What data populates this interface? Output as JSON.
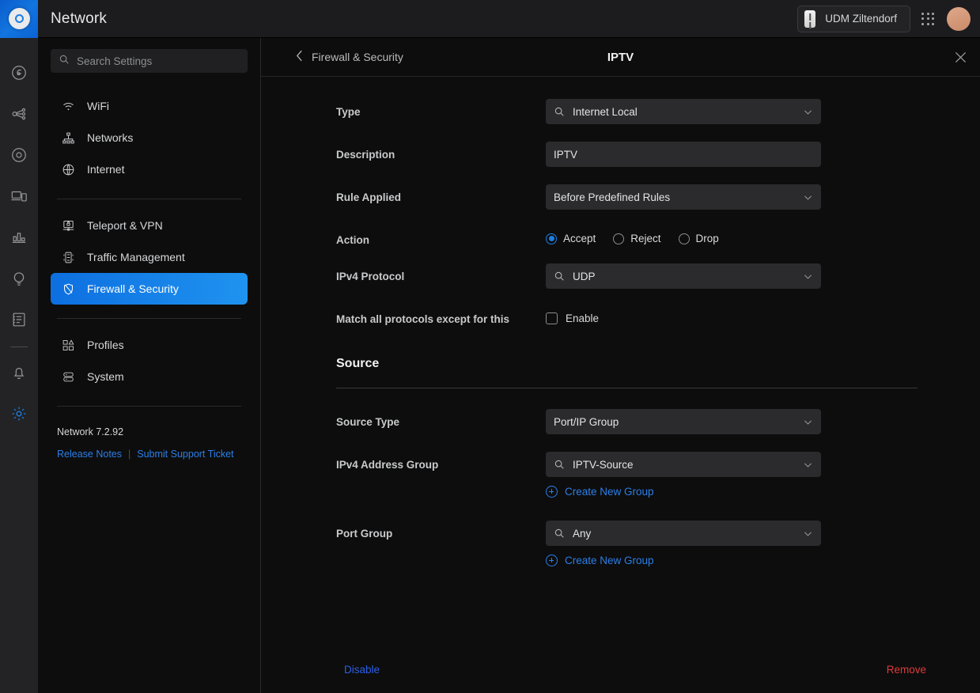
{
  "topbar": {
    "app_title": "Network",
    "logo_icon": "unifi-ap-logo-icon",
    "device_name": "UDM Ziltendorf",
    "device_icon": "udm-device-icon",
    "apps_icon": "apps-grid-icon",
    "avatar_icon": "user-avatar"
  },
  "rail": {
    "items": [
      {
        "name": "dashboard-icon"
      },
      {
        "name": "topology-icon"
      },
      {
        "name": "unifi-devices-icon"
      },
      {
        "name": "client-devices-icon"
      },
      {
        "name": "statistics-icon"
      },
      {
        "name": "insights-icon"
      },
      {
        "name": "logs-icon"
      },
      {
        "name": "notifications-bell-icon"
      },
      {
        "name": "settings-gear-icon"
      }
    ]
  },
  "sidebar": {
    "search": {
      "placeholder": "Search Settings",
      "icon": "search-icon"
    },
    "groups": [
      {
        "items": [
          {
            "label": "WiFi",
            "icon": "wifi-icon",
            "active": false
          },
          {
            "label": "Networks",
            "icon": "networks-icon",
            "active": false
          },
          {
            "label": "Internet",
            "icon": "globe-icon",
            "active": false
          }
        ]
      },
      {
        "items": [
          {
            "label": "Teleport & VPN",
            "icon": "vpn-lock-icon",
            "active": false
          },
          {
            "label": "Traffic Management",
            "icon": "traffic-light-icon",
            "active": false
          },
          {
            "label": "Firewall & Security",
            "icon": "shield-icon",
            "active": true
          }
        ]
      },
      {
        "items": [
          {
            "label": "Profiles",
            "icon": "profiles-icon",
            "active": false
          },
          {
            "label": "System",
            "icon": "system-icon",
            "active": false
          }
        ]
      }
    ],
    "version": "Network 7.2.92",
    "release_notes": "Release Notes",
    "separator": "|",
    "support_ticket": "Submit Support Ticket"
  },
  "panel": {
    "back_label": "Firewall & Security",
    "back_icon": "chevron-left-icon",
    "title": "IPTV",
    "close_icon": "close-icon",
    "rows": {
      "type": {
        "label": "Type",
        "value": "Internet Local",
        "icon": "search-icon",
        "chevron": "chevron-down-icon"
      },
      "description": {
        "label": "Description",
        "value": "IPTV"
      },
      "rule_applied": {
        "label": "Rule Applied",
        "value": "Before Predefined Rules",
        "chevron": "chevron-down-icon"
      },
      "action": {
        "label": "Action",
        "options": [
          {
            "label": "Accept",
            "selected": true
          },
          {
            "label": "Reject",
            "selected": false
          },
          {
            "label": "Drop",
            "selected": false
          }
        ]
      },
      "ipv4_protocol": {
        "label": "IPv4 Protocol",
        "value": "UDP",
        "icon": "search-icon",
        "chevron": "chevron-down-icon"
      },
      "match_all_except": {
        "label": "Match all protocols except for this",
        "checkbox_label": "Enable",
        "checked": false
      }
    },
    "source_section": {
      "title": "Source",
      "source_type": {
        "label": "Source Type",
        "value": "Port/IP Group",
        "chevron": "chevron-down-icon"
      },
      "ipv4_address_group": {
        "label": "IPv4 Address Group",
        "value": "IPTV-Source",
        "icon": "search-icon",
        "chevron": "chevron-down-icon",
        "create_link": "Create New Group",
        "create_icon": "plus-circle-icon"
      },
      "port_group": {
        "label": "Port Group",
        "value": "Any",
        "icon": "search-icon",
        "chevron": "chevron-down-icon",
        "create_link": "Create New Group",
        "create_icon": "plus-circle-icon"
      }
    },
    "footer": {
      "disable_label": "Disable",
      "remove_label": "Remove"
    }
  },
  "colors": {
    "accent_blue": "#1b7fe3",
    "link_blue": "#2b7fe8",
    "danger_red": "#e03a3a",
    "page_bg": "#0d0d0d",
    "field_bg": "#2b2b2d"
  }
}
